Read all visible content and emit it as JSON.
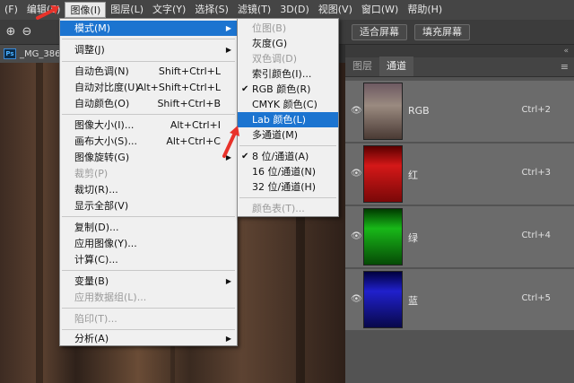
{
  "menubar": {
    "items": [
      "(F)",
      "编辑(E)",
      "图像(I)",
      "图层(L)",
      "文字(Y)",
      "选择(S)",
      "滤镜(T)",
      "3D(D)",
      "视图(V)",
      "窗口(W)",
      "帮助(H)"
    ]
  },
  "options": {
    "fit_screen": "适合屏幕",
    "fill_screen": "填充屏幕"
  },
  "document": {
    "tab_label": "_MG_386",
    "ps_badge": "Ps"
  },
  "image_menu": {
    "mode": "模式(M)",
    "adjust": "调整(J)",
    "auto_tone": {
      "label": "自动色调(N)",
      "shortcut": "Shift+Ctrl+L"
    },
    "auto_contrast": {
      "label": "自动对比度(U)",
      "shortcut": "Alt+Shift+Ctrl+L"
    },
    "auto_color": {
      "label": "自动颜色(O)",
      "shortcut": "Shift+Ctrl+B"
    },
    "image_size": {
      "label": "图像大小(I)...",
      "shortcut": "Alt+Ctrl+I"
    },
    "canvas_size": {
      "label": "画布大小(S)...",
      "shortcut": "Alt+Ctrl+C"
    },
    "rotate": "图像旋转(G)",
    "crop": "裁剪(P)",
    "trim": "裁切(R)...",
    "reveal_all": "显示全部(V)",
    "duplicate": "复制(D)...",
    "apply_image": "应用图像(Y)...",
    "calculations": "计算(C)...",
    "variables": "变量(B)",
    "apply_dataset": "应用数据组(L)...",
    "trap": "陷印(T)...",
    "analysis": "分析(A)"
  },
  "mode_menu": {
    "bitmap": "位图(B)",
    "grayscale": "灰度(G)",
    "duotone": "双色调(D)",
    "indexed": "索引颜色(I)...",
    "rgb": "RGB 颜色(R)",
    "cmyk": "CMYK 颜色(C)",
    "lab": "Lab 颜色(L)",
    "multichannel": "多通道(M)",
    "bits8": "8 位/通道(A)",
    "bits16": "16 位/通道(N)",
    "bits32": "32 位/通道(H)",
    "color_table": "颜色表(T)..."
  },
  "panel": {
    "tab_layers": "图层",
    "tab_channels": "通道",
    "channels": [
      {
        "name": "RGB",
        "shortcut": "Ctrl+2"
      },
      {
        "name": "红",
        "shortcut": "Ctrl+3"
      },
      {
        "name": "绿",
        "shortcut": "Ctrl+4"
      },
      {
        "name": "蓝",
        "shortcut": "Ctrl+5"
      }
    ]
  },
  "colors": {
    "highlight": "#1c74d0",
    "arrow": "#e8322a"
  }
}
